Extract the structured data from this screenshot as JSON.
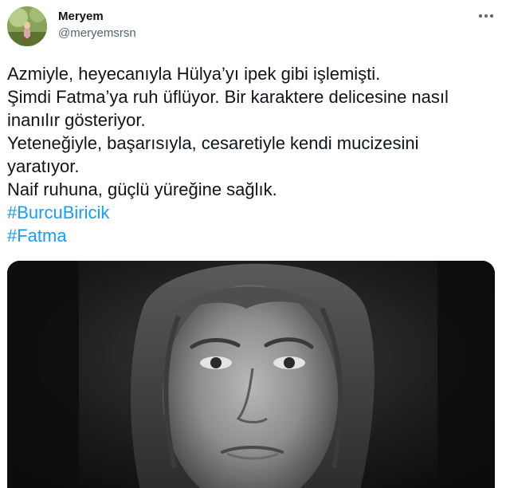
{
  "tweet": {
    "author": {
      "name": "Meryem",
      "handle": "@meryemsrsn",
      "avatar_icon": "profile-avatar"
    },
    "more_icon": "more-options-icon",
    "text_lines": [
      "Azmiyle, heyecanıyla Hülya’yı ipek gibi işlemişti.",
      "Şimdi Fatma’ya ruh üflüyor. Bir karaktere delicesine nasıl",
      "inanılır gösteriyor.",
      "Yeteneğiyle, başarısıyla, cesaretiyle kendi mucizesini",
      "yaratıyor.",
      "Naif ruhuna, güçlü yüreğine sağlık."
    ],
    "hashtags": [
      "#BurcuBiricik",
      "#Fatma"
    ],
    "link_color": "#1d9bf0",
    "media": {
      "description_icon": "tweet-photo"
    }
  }
}
